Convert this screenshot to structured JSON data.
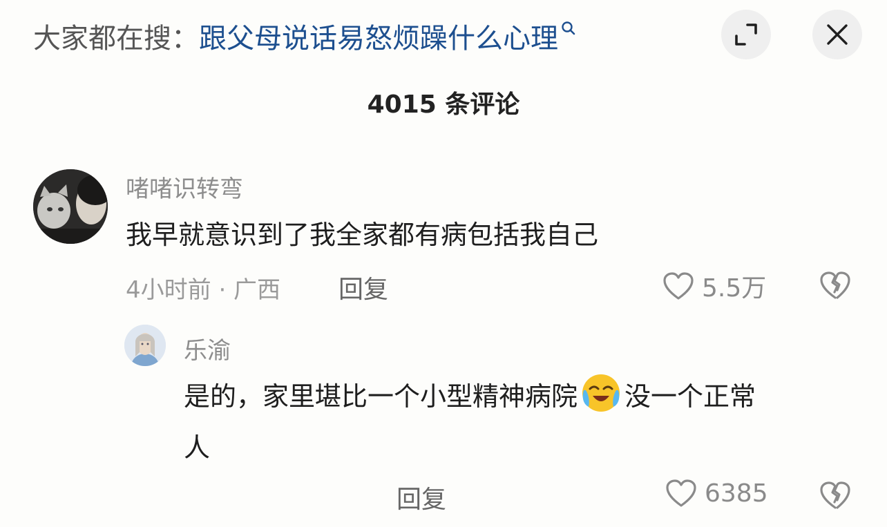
{
  "header": {
    "search_prefix": "大家都在搜：",
    "search_query": "跟父母说话易怒烦躁什么心理"
  },
  "comment_count": "4015 条评论",
  "comments": [
    {
      "username": "啫啫识转弯",
      "content": "我早就意识到了我全家都有病包括我自己",
      "meta": "4小时前 · 广西",
      "reply_label": "回复",
      "likes": "5.5万",
      "replies": [
        {
          "username": "乐渝",
          "content_line1_before_emoji": "是的，家里堪比一个小型精神病院",
          "emoji_name": "crying-laughing-emoji",
          "content_line1_after_emoji": "没一个正常",
          "content_line2": "人",
          "reply_label": "回复",
          "likes": "6385"
        }
      ]
    }
  ],
  "icons": {
    "search": "search-icon",
    "expand": "expand-icon",
    "close": "close-icon",
    "like": "heart-icon",
    "dislike": "broken-heart-icon"
  },
  "colors": {
    "background": "#fdfdfb",
    "search_link": "#1d4f8f",
    "secondary_text": "#8d8d8d",
    "button_bg": "#efefef"
  }
}
